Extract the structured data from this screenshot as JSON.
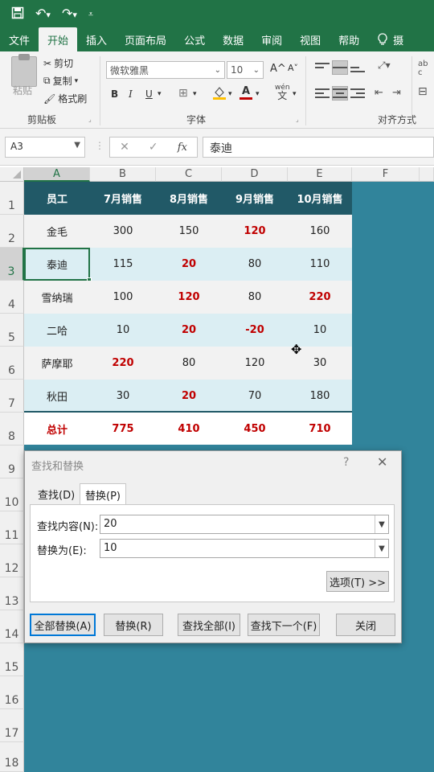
{
  "quick_access": {
    "save_icon": "save-icon",
    "undo_icon": "undo-icon",
    "redo_icon": "redo-icon",
    "customize_icon": "customize-icon"
  },
  "tabs": [
    {
      "label": "文件"
    },
    {
      "label": "开始"
    },
    {
      "label": "插入"
    },
    {
      "label": "页面布局"
    },
    {
      "label": "公式"
    },
    {
      "label": "数据"
    },
    {
      "label": "审阅"
    },
    {
      "label": "视图"
    },
    {
      "label": "帮助"
    }
  ],
  "active_tab": "开始",
  "tellme_icon": "lightbulb-icon",
  "tellme_label": "摄",
  "ribbon": {
    "clipboard": {
      "paste": "粘贴",
      "cut": "剪切",
      "copy": "复制",
      "format_painter": "格式刷",
      "group": "剪贴板"
    },
    "font": {
      "name": "微软雅黑",
      "size": "10",
      "group": "字体",
      "grow": "A^",
      "shrink": "A˅",
      "bold": "B",
      "italic": "I",
      "underline": "U",
      "wen": "wén",
      "wen2": "文",
      "font_color_letter": "A"
    },
    "alignment": {
      "group": "对齐方式",
      "wrap_label": "ab c"
    }
  },
  "formula_bar": {
    "name_box": "A3",
    "content": "泰迪",
    "fx": "fx"
  },
  "columns": [
    "A",
    "B",
    "C",
    "D",
    "E",
    "F"
  ],
  "rows": [
    "1",
    "2",
    "3",
    "4",
    "5",
    "6",
    "7",
    "8",
    "9",
    "10",
    "11",
    "12",
    "13",
    "14",
    "15",
    "16",
    "17",
    "18"
  ],
  "table": {
    "headers": [
      "员工",
      "7月销售",
      "8月销售",
      "9月销售",
      "10月销售"
    ],
    "rows": [
      {
        "cells": [
          "金毛",
          "300",
          "150",
          "120",
          "160"
        ]
      },
      {
        "cells": [
          "泰迪",
          "115",
          "20",
          "80",
          "110"
        ]
      },
      {
        "cells": [
          "雪纳瑞",
          "100",
          "120",
          "80",
          "220"
        ]
      },
      {
        "cells": [
          "二哈",
          "10",
          "20",
          "-20",
          "10"
        ]
      },
      {
        "cells": [
          "萨摩耶",
          "220",
          "80",
          "120",
          "30"
        ]
      },
      {
        "cells": [
          "秋田",
          "30",
          "20",
          "70",
          "180"
        ]
      }
    ],
    "total": [
      "总计",
      "775",
      "410",
      "450",
      "710"
    ],
    "highlight_color": "#c00000"
  },
  "dialog": {
    "title": "查找和替换",
    "help": "?",
    "close": "✕",
    "tab_find": "查找(D)",
    "tab_replace": "替换(P)",
    "find_label": "查找内容(N):",
    "find_value": "20",
    "replace_label": "替换为(E):",
    "replace_value": "10",
    "options_button": "选项(T) >>",
    "replace_all": "全部替换(A)",
    "replace": "替换(R)",
    "find_all": "查找全部(I)",
    "find_next": "查找下一个(F)",
    "close_button": "关闭"
  }
}
